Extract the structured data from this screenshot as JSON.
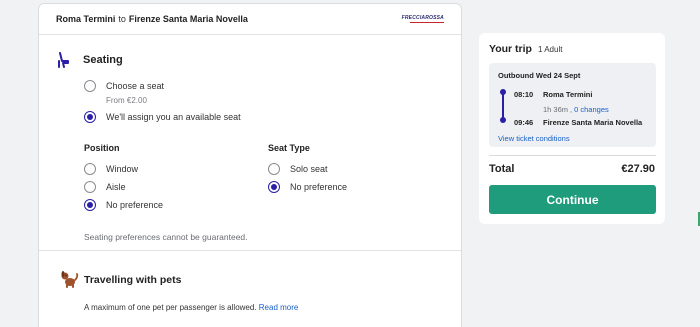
{
  "route": {
    "origin": "Roma Termini",
    "connector": "to",
    "destination": "Firenze Santa Maria Novella",
    "operator_logo": "FRECCIAROSSA"
  },
  "seating": {
    "title": "Seating",
    "icon": "seat-icon",
    "options": [
      {
        "label": "Choose a seat",
        "sub": "From €2.00",
        "checked": false
      },
      {
        "label": "We'll assign you an available seat",
        "checked": true
      }
    ],
    "position": {
      "label": "Position",
      "options": [
        {
          "label": "Window",
          "checked": false
        },
        {
          "label": "Aisle",
          "checked": false
        },
        {
          "label": "No preference",
          "checked": true
        }
      ]
    },
    "seat_type": {
      "label": "Seat Type",
      "options": [
        {
          "label": "Solo seat",
          "checked": false
        },
        {
          "label": "No preference",
          "checked": true
        }
      ]
    },
    "disclaimer": "Seating preferences cannot be guaranteed."
  },
  "pets": {
    "title": "Travelling with pets",
    "icon": "dog-icon",
    "description": "A maximum of one pet per passenger is allowed.",
    "link": "Read more"
  },
  "trip": {
    "title": "Your trip",
    "passengers": "1 Adult",
    "outbound_label": "Outbound Wed 24 Sept",
    "departure": {
      "time": "08:10",
      "station": "Roma Termini"
    },
    "duration": "1h 36m",
    "separator": ",",
    "changes": "0 changes",
    "arrival": {
      "time": "09:46",
      "station": "Firenze Santa Maria Novella"
    },
    "ticket_conditions": "View ticket conditions",
    "total_label": "Total",
    "total_price": "€27.90",
    "continue_label": "Continue"
  },
  "colors": {
    "accent": "#2a1fa6",
    "continue": "#1f9c7c",
    "link": "#1a5fc8"
  }
}
